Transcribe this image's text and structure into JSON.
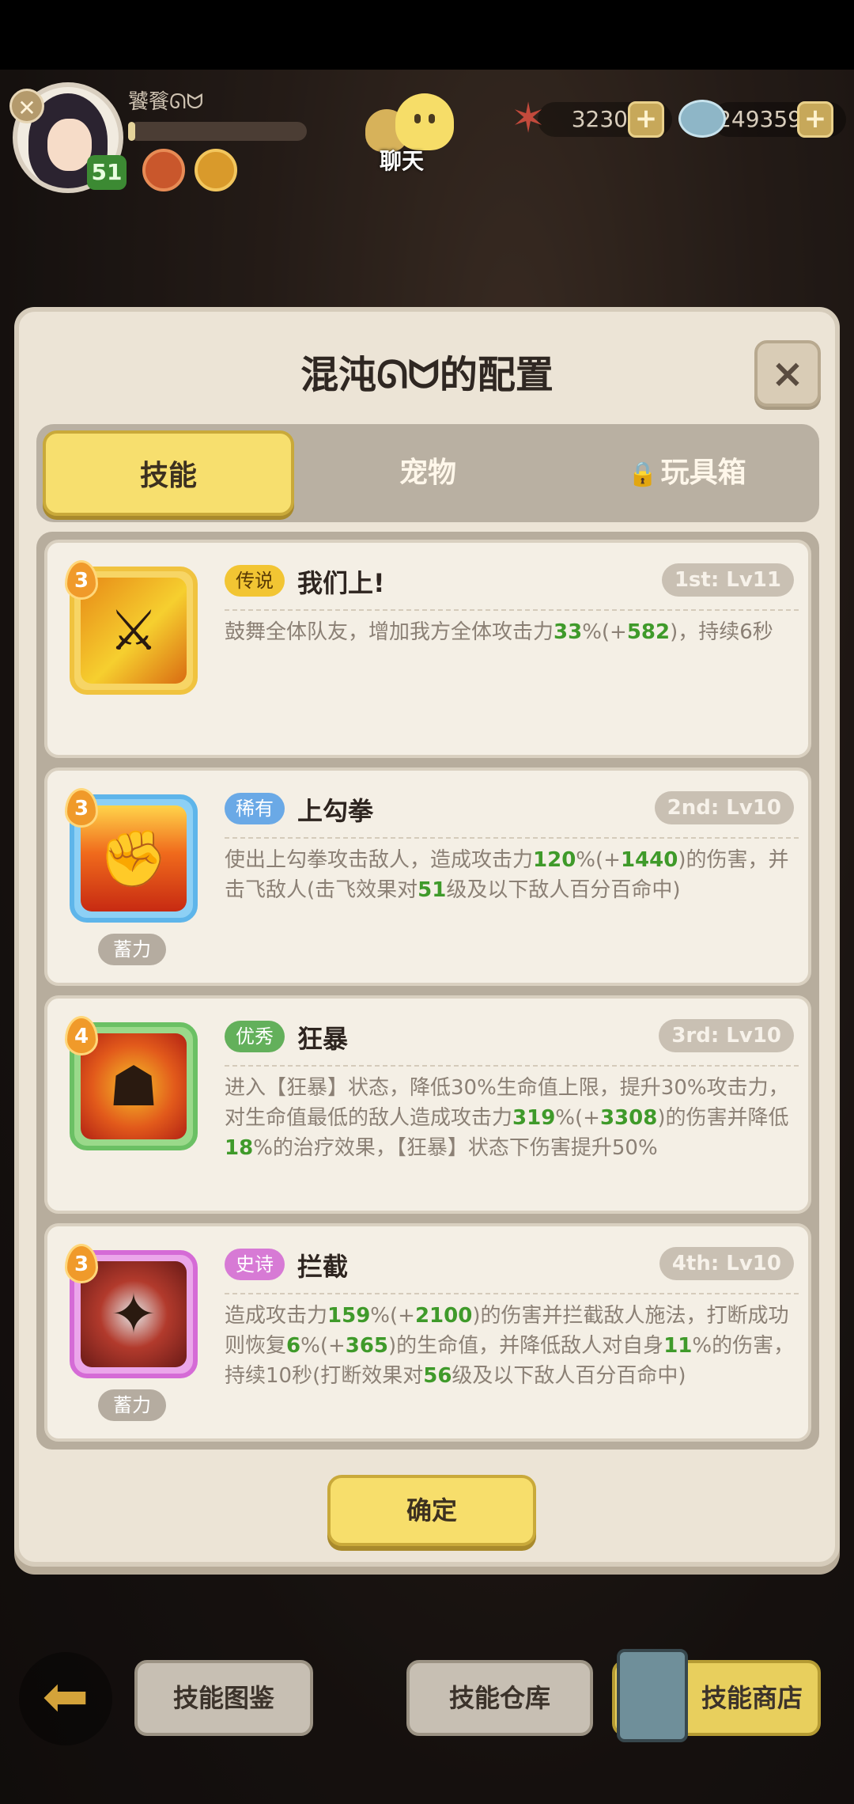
{
  "hud": {
    "player_name": "饕餮ᘏᗢ",
    "level": "51",
    "exp_progress": 0.04,
    "chat_label": "聊天",
    "currency_star": "3230",
    "currency_gem": "249359",
    "plus": "+"
  },
  "panel": {
    "title": "混沌ᘏᗢ的配置",
    "close": "×",
    "tabs": [
      {
        "label": "技能",
        "active": true
      },
      {
        "label": "宠物",
        "active": false
      },
      {
        "label": "玩具箱",
        "active": false,
        "locked": true
      }
    ],
    "lock_glyph": "🔒",
    "skills": [
      {
        "stars": "3",
        "rarity": "传说",
        "name": "我们上!",
        "slot": "1st: Lv11",
        "desc_parts": [
          "鼓舞全体队友，增加我方全体攻击力",
          "33",
          "%(+",
          "582",
          ")，持续6秒"
        ]
      },
      {
        "stars": "3",
        "rarity": "稀有",
        "name": "上勾拳",
        "slot": "2nd: Lv10",
        "charge": "蓄力",
        "desc_parts": [
          "使出上勾拳攻击敌人，造成攻击力",
          "120",
          "%(+",
          "1440",
          ")的伤害，并击飞敌人(击飞效果对",
          "51",
          "级及以下敌人百分百命中)"
        ]
      },
      {
        "stars": "4",
        "rarity": "优秀",
        "name": "狂暴",
        "slot": "3rd: Lv10",
        "desc_parts": [
          "进入【狂暴】状态，降低30%生命值上限，提升30%攻击力，对生命值最低的敌人造成攻击力",
          "319",
          "%(+",
          "3308",
          ")的伤害并降低",
          "18",
          "%的治疗效果，【狂暴】状态下伤害提升50%"
        ]
      },
      {
        "stars": "3",
        "rarity": "史诗",
        "name": "拦截",
        "slot": "4th: Lv10",
        "charge": "蓄力",
        "desc_parts": [
          "造成攻击力",
          "159",
          "%(+",
          "2100",
          ")的伤害并拦截敌人施法，打断成功则恢复",
          "6",
          "%(+",
          "365",
          ")的生命值，并降低敌人对自身",
          "11",
          "%的伤害，持续10秒(打断效果对",
          "56",
          "级及以下敌人百分百命中)"
        ]
      }
    ],
    "confirm": "确定"
  },
  "bottom": {
    "back": "⬅",
    "catalog": "技能图鉴",
    "warehouse": "技能仓库",
    "shop": "技能商店"
  }
}
